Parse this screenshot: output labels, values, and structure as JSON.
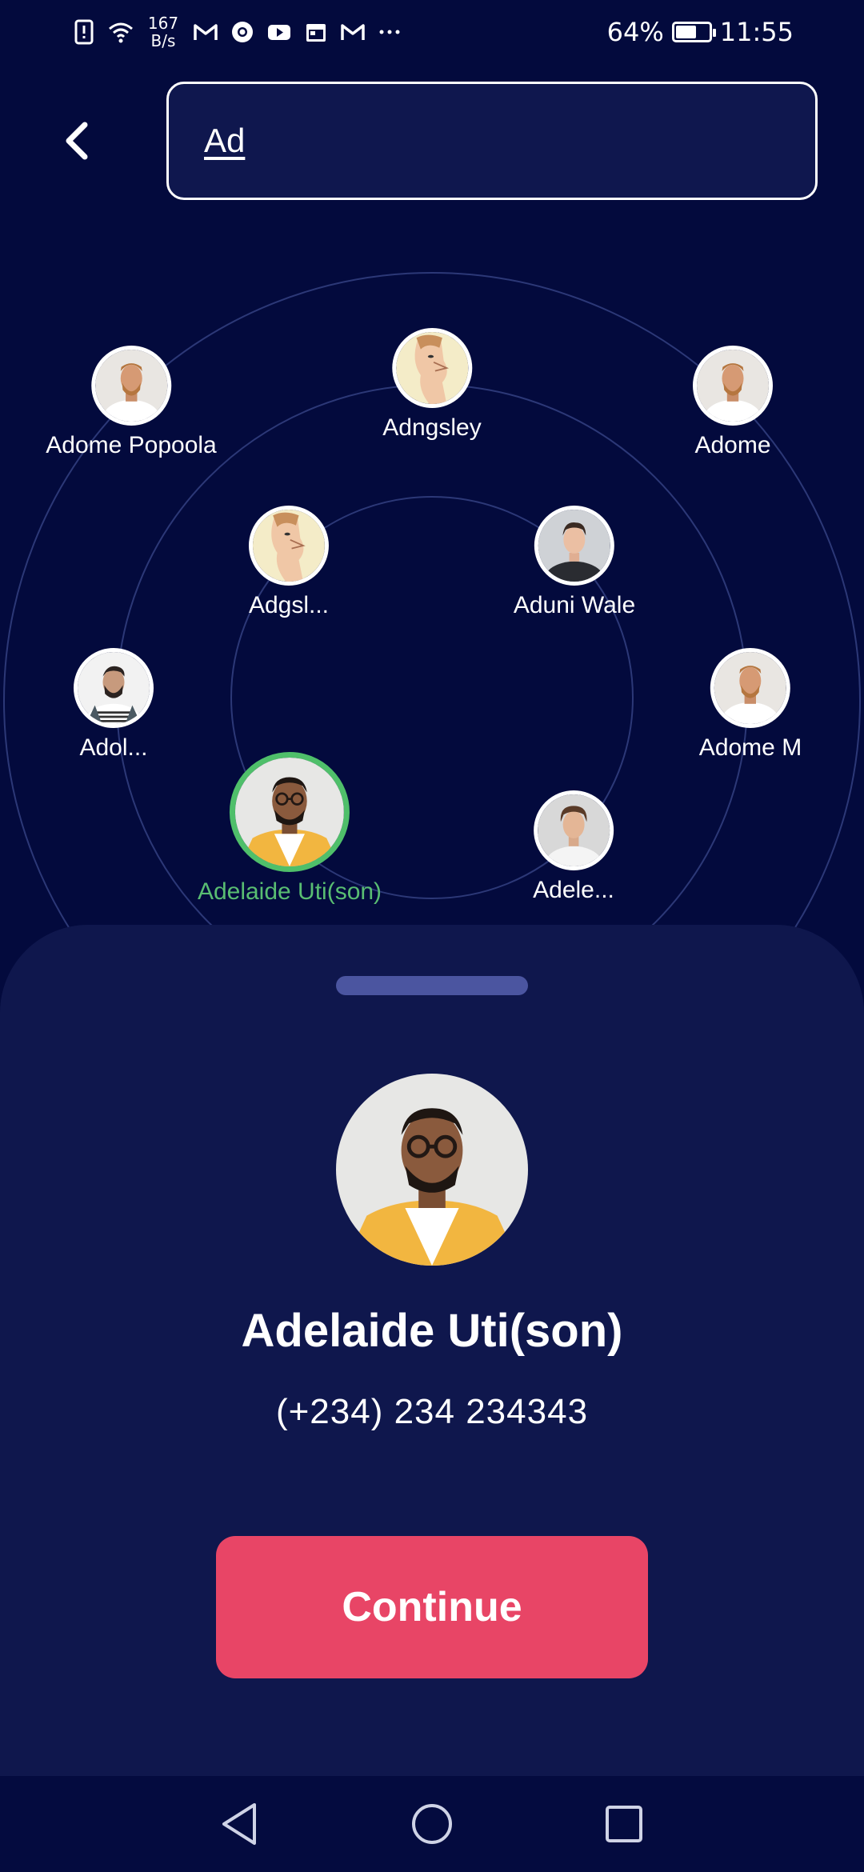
{
  "status_bar": {
    "net_speed_value": "167",
    "net_speed_unit": "B/s",
    "battery_percent_text": "64%",
    "battery_level": 0.64,
    "time": "11:55",
    "icons": [
      "alert-icon",
      "wifi-icon",
      "gmail-icon",
      "chrome-icon",
      "youtube-icon",
      "calendar-icon",
      "gmail-icon",
      "more-icon"
    ]
  },
  "header": {
    "back_icon": "chevron-left-icon",
    "search_value": "Ad"
  },
  "contacts": [
    {
      "id": "adome-popoola",
      "name": "Adome Popoola",
      "photo": "man-beard-white-shirt"
    },
    {
      "id": "adngsley",
      "name": "Adngsley",
      "photo": "face-profile-art"
    },
    {
      "id": "adome",
      "name": "Adome",
      "photo": "man-beard-white-shirt"
    },
    {
      "id": "adgsl",
      "name": "Adgsl...",
      "photo": "face-profile-art"
    },
    {
      "id": "aduni-wale",
      "name": "Aduni Wale",
      "photo": "man-dark-tshirt"
    },
    {
      "id": "adol",
      "name": "Adol...",
      "photo": "man-striped-shirt"
    },
    {
      "id": "adome-m",
      "name": "Adome M",
      "photo": "man-beard-white-shirt"
    },
    {
      "id": "adelaide-uti",
      "name": "Adelaide Uti(son)",
      "photo": "man-glasses-yellow-shirt",
      "selected": true
    },
    {
      "id": "adele",
      "name": "Adele...",
      "photo": "man-white-shirt"
    }
  ],
  "selected_contact": {
    "name": "Adelaide Uti(son)",
    "phone": "(+234) 234 234343",
    "photo": "man-glasses-yellow-shirt"
  },
  "actions": {
    "continue_label": "Continue"
  },
  "colors": {
    "background": "#030a3d",
    "sheet": "#0f174d",
    "accent": "#e84566",
    "selected": "#4fbf6a"
  },
  "nav_bar": {
    "icons": [
      "back-triangle-icon",
      "home-circle-icon",
      "recents-square-icon"
    ]
  }
}
